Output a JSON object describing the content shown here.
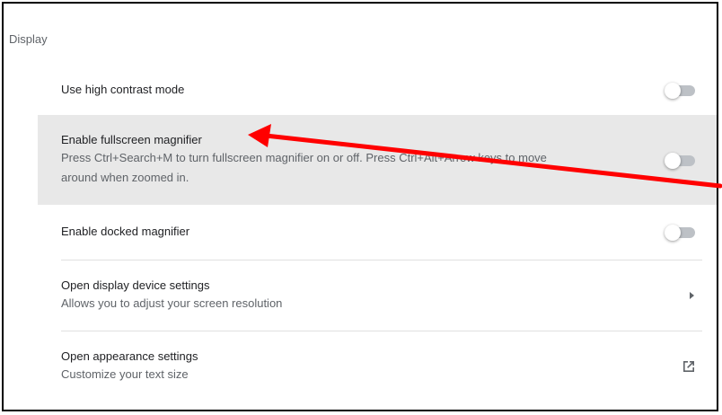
{
  "section": {
    "title": "Display"
  },
  "settings": [
    {
      "label": "Use high contrast mode",
      "control": "toggle",
      "enabled": false
    },
    {
      "label": "Enable fullscreen magnifier",
      "description": "Press Ctrl+Search+M to turn fullscreen magnifier on or off. Press Ctrl+Alt+Arrow keys to move",
      "description2": "around when zoomed in.",
      "control": "toggle",
      "enabled": false,
      "highlighted": true
    },
    {
      "label": "Enable docked magnifier",
      "control": "toggle",
      "enabled": false
    },
    {
      "label": "Open display device settings",
      "description": "Allows you to adjust your screen resolution",
      "control": "chevron-right-icon"
    },
    {
      "label": "Open appearance settings",
      "description": "Customize your text size",
      "control": "open-in-new-icon"
    }
  ],
  "colors": {
    "highlight_row": "#e8e8e8",
    "annotation_arrow": "#ff0000",
    "toggle_track_off": "#bdc1c6",
    "frame_border": "#000000"
  }
}
